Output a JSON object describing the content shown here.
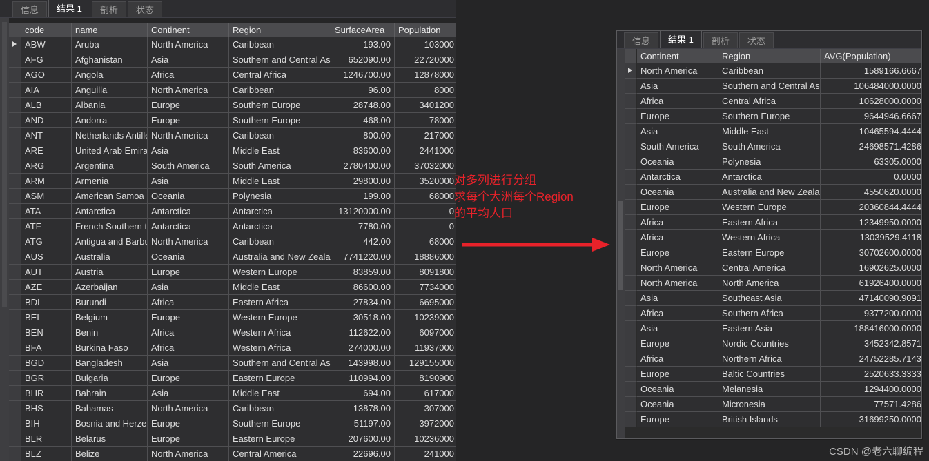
{
  "main_panel": {
    "tabs": [
      {
        "label": "信息",
        "active": false
      },
      {
        "label": "结果 1",
        "active": true
      },
      {
        "label": "剖析",
        "active": false
      },
      {
        "label": "状态",
        "active": false
      }
    ],
    "columns": [
      "code",
      "name",
      "Continent",
      "Region",
      "SurfaceArea",
      "Population"
    ],
    "rows": [
      {
        "selected": true,
        "code": "ABW",
        "name": "Aruba",
        "continent": "North America",
        "region": "Caribbean",
        "surface_area": "193.00",
        "population": "103000"
      },
      {
        "selected": false,
        "code": "AFG",
        "name": "Afghanistan",
        "continent": "Asia",
        "region": "Southern and Central Asia",
        "surface_area": "652090.00",
        "population": "22720000"
      },
      {
        "selected": false,
        "code": "AGO",
        "name": "Angola",
        "continent": "Africa",
        "region": "Central Africa",
        "surface_area": "1246700.00",
        "population": "12878000"
      },
      {
        "selected": false,
        "code": "AIA",
        "name": "Anguilla",
        "continent": "North America",
        "region": "Caribbean",
        "surface_area": "96.00",
        "population": "8000"
      },
      {
        "selected": false,
        "code": "ALB",
        "name": "Albania",
        "continent": "Europe",
        "region": "Southern Europe",
        "surface_area": "28748.00",
        "population": "3401200"
      },
      {
        "selected": false,
        "code": "AND",
        "name": "Andorra",
        "continent": "Europe",
        "region": "Southern Europe",
        "surface_area": "468.00",
        "population": "78000"
      },
      {
        "selected": false,
        "code": "ANT",
        "name": "Netherlands Antilles",
        "continent": "North America",
        "region": "Caribbean",
        "surface_area": "800.00",
        "population": "217000"
      },
      {
        "selected": false,
        "code": "ARE",
        "name": "United Arab Emirates",
        "continent": "Asia",
        "region": "Middle East",
        "surface_area": "83600.00",
        "population": "2441000"
      },
      {
        "selected": false,
        "code": "ARG",
        "name": "Argentina",
        "continent": "South America",
        "region": "South America",
        "surface_area": "2780400.00",
        "population": "37032000"
      },
      {
        "selected": false,
        "code": "ARM",
        "name": "Armenia",
        "continent": "Asia",
        "region": "Middle East",
        "surface_area": "29800.00",
        "population": "3520000"
      },
      {
        "selected": false,
        "code": "ASM",
        "name": "American Samoa",
        "continent": "Oceania",
        "region": "Polynesia",
        "surface_area": "199.00",
        "population": "68000"
      },
      {
        "selected": false,
        "code": "ATA",
        "name": "Antarctica",
        "continent": "Antarctica",
        "region": "Antarctica",
        "surface_area": "13120000.00",
        "population": "0"
      },
      {
        "selected": false,
        "code": "ATF",
        "name": "French Southern territories",
        "continent": "Antarctica",
        "region": "Antarctica",
        "surface_area": "7780.00",
        "population": "0"
      },
      {
        "selected": false,
        "code": "ATG",
        "name": "Antigua and Barbuda",
        "continent": "North America",
        "region": "Caribbean",
        "surface_area": "442.00",
        "population": "68000"
      },
      {
        "selected": false,
        "code": "AUS",
        "name": "Australia",
        "continent": "Oceania",
        "region": "Australia and New Zealand",
        "surface_area": "7741220.00",
        "population": "18886000"
      },
      {
        "selected": false,
        "code": "AUT",
        "name": "Austria",
        "continent": "Europe",
        "region": "Western Europe",
        "surface_area": "83859.00",
        "population": "8091800"
      },
      {
        "selected": false,
        "code": "AZE",
        "name": "Azerbaijan",
        "continent": "Asia",
        "region": "Middle East",
        "surface_area": "86600.00",
        "population": "7734000"
      },
      {
        "selected": false,
        "code": "BDI",
        "name": "Burundi",
        "continent": "Africa",
        "region": "Eastern Africa",
        "surface_area": "27834.00",
        "population": "6695000"
      },
      {
        "selected": false,
        "code": "BEL",
        "name": "Belgium",
        "continent": "Europe",
        "region": "Western Europe",
        "surface_area": "30518.00",
        "population": "10239000"
      },
      {
        "selected": false,
        "code": "BEN",
        "name": "Benin",
        "continent": "Africa",
        "region": "Western Africa",
        "surface_area": "112622.00",
        "population": "6097000"
      },
      {
        "selected": false,
        "code": "BFA",
        "name": "Burkina Faso",
        "continent": "Africa",
        "region": "Western Africa",
        "surface_area": "274000.00",
        "population": "11937000"
      },
      {
        "selected": false,
        "code": "BGD",
        "name": "Bangladesh",
        "continent": "Asia",
        "region": "Southern and Central Asia",
        "surface_area": "143998.00",
        "population": "129155000"
      },
      {
        "selected": false,
        "code": "BGR",
        "name": "Bulgaria",
        "continent": "Europe",
        "region": "Eastern Europe",
        "surface_area": "110994.00",
        "population": "8190900"
      },
      {
        "selected": false,
        "code": "BHR",
        "name": "Bahrain",
        "continent": "Asia",
        "region": "Middle East",
        "surface_area": "694.00",
        "population": "617000"
      },
      {
        "selected": false,
        "code": "BHS",
        "name": "Bahamas",
        "continent": "North America",
        "region": "Caribbean",
        "surface_area": "13878.00",
        "population": "307000"
      },
      {
        "selected": false,
        "code": "BIH",
        "name": "Bosnia and Herzegovina",
        "continent": "Europe",
        "region": "Southern Europe",
        "surface_area": "51197.00",
        "population": "3972000"
      },
      {
        "selected": false,
        "code": "BLR",
        "name": "Belarus",
        "continent": "Europe",
        "region": "Eastern Europe",
        "surface_area": "207600.00",
        "population": "10236000"
      },
      {
        "selected": false,
        "code": "BLZ",
        "name": "Belize",
        "continent": "North America",
        "region": "Central America",
        "surface_area": "22696.00",
        "population": "241000"
      }
    ]
  },
  "annotation": {
    "text": "对多列进行分组\n求每个大洲每个Region\n的平均人口",
    "color": "#e8222a"
  },
  "inset_panel": {
    "tabs": [
      {
        "label": "信息",
        "active": false
      },
      {
        "label": "结果 1",
        "active": true
      },
      {
        "label": "剖析",
        "active": false
      },
      {
        "label": "状态",
        "active": false
      }
    ],
    "columns": [
      "Continent",
      "Region",
      "AVG(Population)"
    ],
    "rows": [
      {
        "selected": true,
        "continent": "North America",
        "region": "Caribbean",
        "avg_population": "1589166.6667"
      },
      {
        "selected": false,
        "continent": "Asia",
        "region": "Southern and Central Asia",
        "avg_population": "106484000.0000"
      },
      {
        "selected": false,
        "continent": "Africa",
        "region": "Central Africa",
        "avg_population": "10628000.0000"
      },
      {
        "selected": false,
        "continent": "Europe",
        "region": "Southern Europe",
        "avg_population": "9644946.6667"
      },
      {
        "selected": false,
        "continent": "Asia",
        "region": "Middle East",
        "avg_population": "10465594.4444"
      },
      {
        "selected": false,
        "continent": "South America",
        "region": "South America",
        "avg_population": "24698571.4286"
      },
      {
        "selected": false,
        "continent": "Oceania",
        "region": "Polynesia",
        "avg_population": "63305.0000"
      },
      {
        "selected": false,
        "continent": "Antarctica",
        "region": "Antarctica",
        "avg_population": "0.0000"
      },
      {
        "selected": false,
        "continent": "Oceania",
        "region": "Australia and New Zealand",
        "avg_population": "4550620.0000"
      },
      {
        "selected": false,
        "continent": "Europe",
        "region": "Western Europe",
        "avg_population": "20360844.4444"
      },
      {
        "selected": false,
        "continent": "Africa",
        "region": "Eastern Africa",
        "avg_population": "12349950.0000"
      },
      {
        "selected": false,
        "continent": "Africa",
        "region": "Western Africa",
        "avg_population": "13039529.4118"
      },
      {
        "selected": false,
        "continent": "Europe",
        "region": "Eastern Europe",
        "avg_population": "30702600.0000"
      },
      {
        "selected": false,
        "continent": "North America",
        "region": "Central America",
        "avg_population": "16902625.0000"
      },
      {
        "selected": false,
        "continent": "North America",
        "region": "North America",
        "avg_population": "61926400.0000"
      },
      {
        "selected": false,
        "continent": "Asia",
        "region": "Southeast Asia",
        "avg_population": "47140090.9091"
      },
      {
        "selected": false,
        "continent": "Africa",
        "region": "Southern Africa",
        "avg_population": "9377200.0000"
      },
      {
        "selected": false,
        "continent": "Asia",
        "region": "Eastern Asia",
        "avg_population": "188416000.0000"
      },
      {
        "selected": false,
        "continent": "Europe",
        "region": "Nordic Countries",
        "avg_population": "3452342.8571"
      },
      {
        "selected": false,
        "continent": "Africa",
        "region": "Northern Africa",
        "avg_population": "24752285.7143"
      },
      {
        "selected": false,
        "continent": "Europe",
        "region": "Baltic Countries",
        "avg_population": "2520633.3333"
      },
      {
        "selected": false,
        "continent": "Oceania",
        "region": "Melanesia",
        "avg_population": "1294400.0000"
      },
      {
        "selected": false,
        "continent": "Oceania",
        "region": "Micronesia",
        "avg_population": "77571.4286"
      },
      {
        "selected": false,
        "continent": "Europe",
        "region": "British Islands",
        "avg_population": "31699250.0000"
      }
    ]
  },
  "watermark": {
    "text": "CSDN @老六聊编程"
  }
}
